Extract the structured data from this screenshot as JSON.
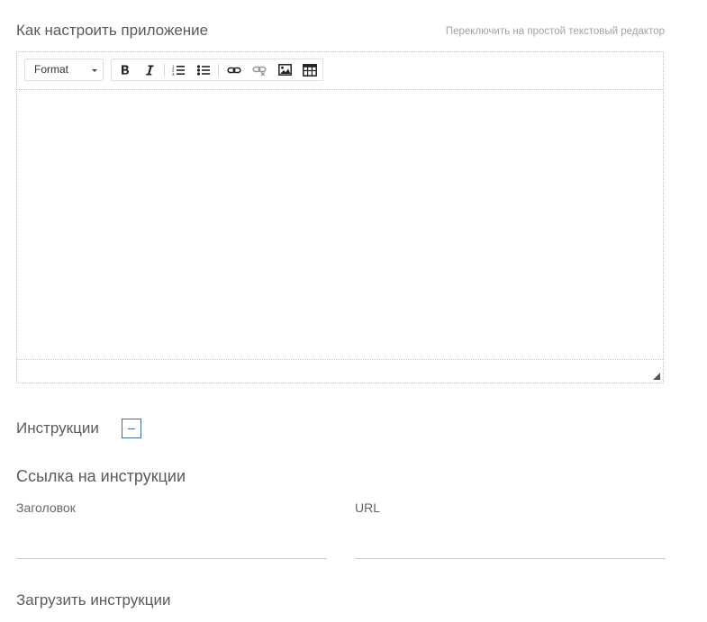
{
  "header": {
    "title": "Как настроить приложение",
    "switch_link": "Переключить на простой текстовый редактор"
  },
  "toolbar": {
    "format_label": "Format",
    "buttons": [
      {
        "icon": "bold-icon"
      },
      {
        "icon": "italic-icon"
      },
      {
        "icon": "numbered-list-icon"
      },
      {
        "icon": "bulleted-list-icon"
      },
      {
        "icon": "link-icon"
      },
      {
        "icon": "unlink-icon"
      },
      {
        "icon": "image-icon"
      },
      {
        "icon": "table-icon"
      }
    ]
  },
  "instructions": {
    "label": "Инструкции",
    "toggle_symbol": "−"
  },
  "link_section": {
    "title": "Ссылка на инструкции",
    "heading_label": "Заголовок",
    "heading_value": "",
    "url_label": "URL",
    "url_value": ""
  },
  "upload_section": {
    "title": "Загрузить инструкции"
  },
  "colors": {
    "accent": "#3a6ea5",
    "text": "#555555",
    "muted": "#a3a3a3"
  }
}
